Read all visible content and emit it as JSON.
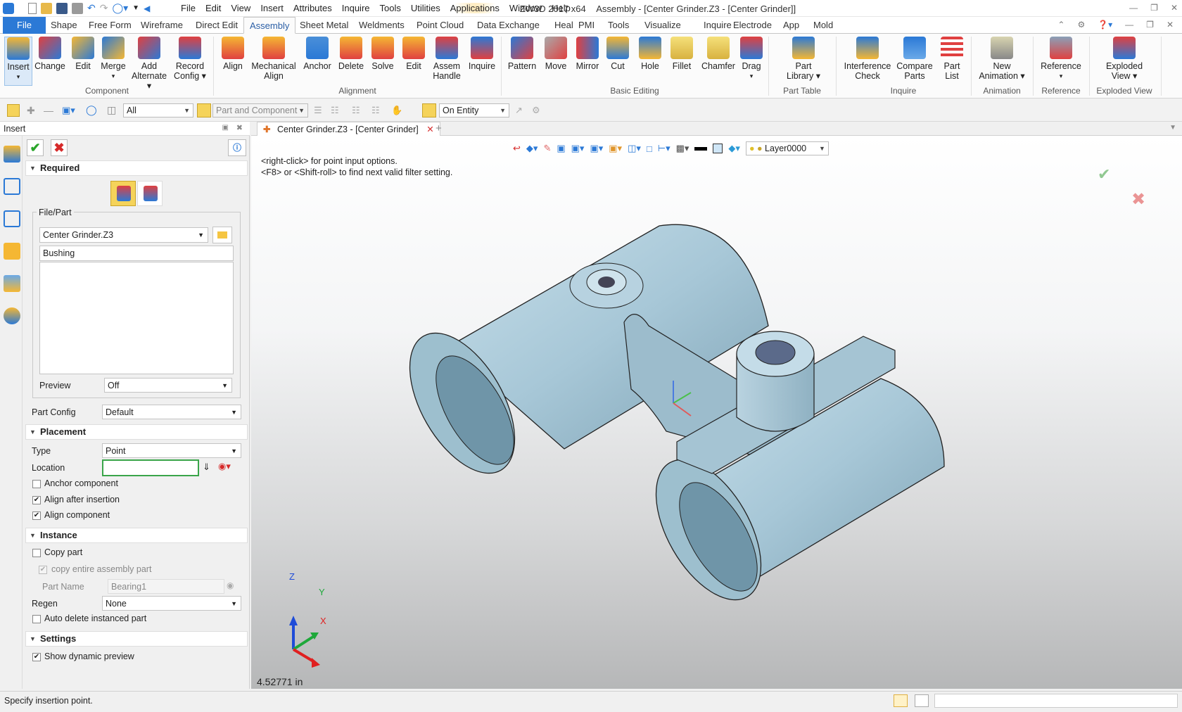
{
  "app": {
    "title": "ZW3D 2017  x64",
    "document_title": "Assembly - [Center Grinder.Z3 - [Center Grinder]]"
  },
  "menubar": [
    "File",
    "Edit",
    "View",
    "Insert",
    "Attributes",
    "Inquire",
    "Tools",
    "Utilities",
    "Applications",
    "Window",
    "Help"
  ],
  "ribbon_tabs": [
    "File",
    "Shape",
    "Free Form",
    "Wireframe",
    "Direct Edit",
    "Assembly",
    "Sheet Metal",
    "Weldments",
    "Point Cloud",
    "Data Exchange",
    "Heal",
    "PMI",
    "Tools",
    "Visualize",
    "Inquire",
    "Electrode",
    "App",
    "Mold"
  ],
  "active_tab": "Assembly",
  "ribbon": {
    "groups": {
      "component": "Component",
      "alignment": "Alignment",
      "basic_editing": "Basic Editing",
      "part_table": "Part Table",
      "inquire": "Inquire",
      "animation": "Animation",
      "reference": "Reference",
      "exploded_view": "Exploded View"
    },
    "buttons": {
      "insert": [
        "Insert",
        "▾"
      ],
      "change": [
        "Change",
        ""
      ],
      "edit": [
        "Edit",
        ""
      ],
      "merge": [
        "Merge",
        "▾"
      ],
      "add_alternate": [
        "Add",
        "Alternate ▾"
      ],
      "record_config": [
        "Record",
        "Config ▾"
      ],
      "align": [
        "Align",
        ""
      ],
      "mechanical_align": [
        "Mechanical",
        "Align"
      ],
      "anchor": [
        "Anchor",
        ""
      ],
      "delete": [
        "Delete",
        ""
      ],
      "solve": [
        "Solve",
        ""
      ],
      "edit2": [
        "Edit",
        ""
      ],
      "assem_handle": [
        "Assem",
        "Handle"
      ],
      "inquire": [
        "Inquire",
        ""
      ],
      "pattern": [
        "Pattern",
        ""
      ],
      "move": [
        "Move",
        ""
      ],
      "mirror": [
        "Mirror",
        ""
      ],
      "cut": [
        "Cut",
        ""
      ],
      "hole": [
        "Hole",
        ""
      ],
      "fillet": [
        "Fillet",
        ""
      ],
      "chamfer": [
        "Chamfer",
        ""
      ],
      "drag": [
        "Drag",
        "▾"
      ],
      "part_library": [
        "Part",
        "Library ▾"
      ],
      "interference_check": [
        "Interference",
        "Check"
      ],
      "compare_parts": [
        "Compare",
        "Parts"
      ],
      "part_list": [
        "Part",
        "List"
      ],
      "new_animation": [
        "New",
        "Animation ▾"
      ],
      "reference": [
        "Reference",
        "▾"
      ],
      "exploded_view": [
        "Exploded",
        "View  ▾"
      ]
    }
  },
  "toolbar2": {
    "filter": "All",
    "pick_mode": "Part and Component",
    "snap": "On Entity"
  },
  "panel": {
    "title": "Insert",
    "required": "Required",
    "file_part_label": "File/Part",
    "file_value": "Center Grinder.Z3",
    "part_value": "Bushing",
    "preview_label": "Preview",
    "preview_value": "Off",
    "part_config_label": "Part Config",
    "part_config_value": "Default",
    "placement": "Placement",
    "type_label": "Type",
    "type_value": "Point",
    "location_label": "Location",
    "location_value": "",
    "anchor_component": "Anchor component",
    "align_after_insertion": "Align after insertion",
    "align_component": "Align component",
    "instance": "Instance",
    "copy_part": "Copy part",
    "copy_entire": "copy entire assembly part",
    "part_name_label": "Part  Name",
    "part_name_value": "Bearing1",
    "regen_label": "Regen",
    "regen_value": "None",
    "auto_delete": "Auto delete instanced part",
    "settings": "Settings",
    "show_preview": "Show dynamic preview",
    "checks": {
      "anchor_component": false,
      "align_after_insertion": true,
      "align_component": true,
      "copy_part": false,
      "copy_entire": true,
      "auto_delete": false,
      "show_preview": true
    }
  },
  "document_tab": "Center Grinder.Z3 - [Center Grinder]",
  "viewport": {
    "layer": "Layer0000",
    "hint1": "<right-click> for point input options.",
    "hint2": "<F8> or <Shift-roll> to find next valid filter setting.",
    "measurement": "4.52771 in",
    "axis_x": "X",
    "axis_y": "Y",
    "axis_z": "Z"
  },
  "status": {
    "text": "Specify insertion point."
  },
  "colors": {
    "accent": "#2b79d6",
    "part_fill": "#a9c9d9",
    "accept": "#2aa52a",
    "cancel": "#d62a2a"
  }
}
